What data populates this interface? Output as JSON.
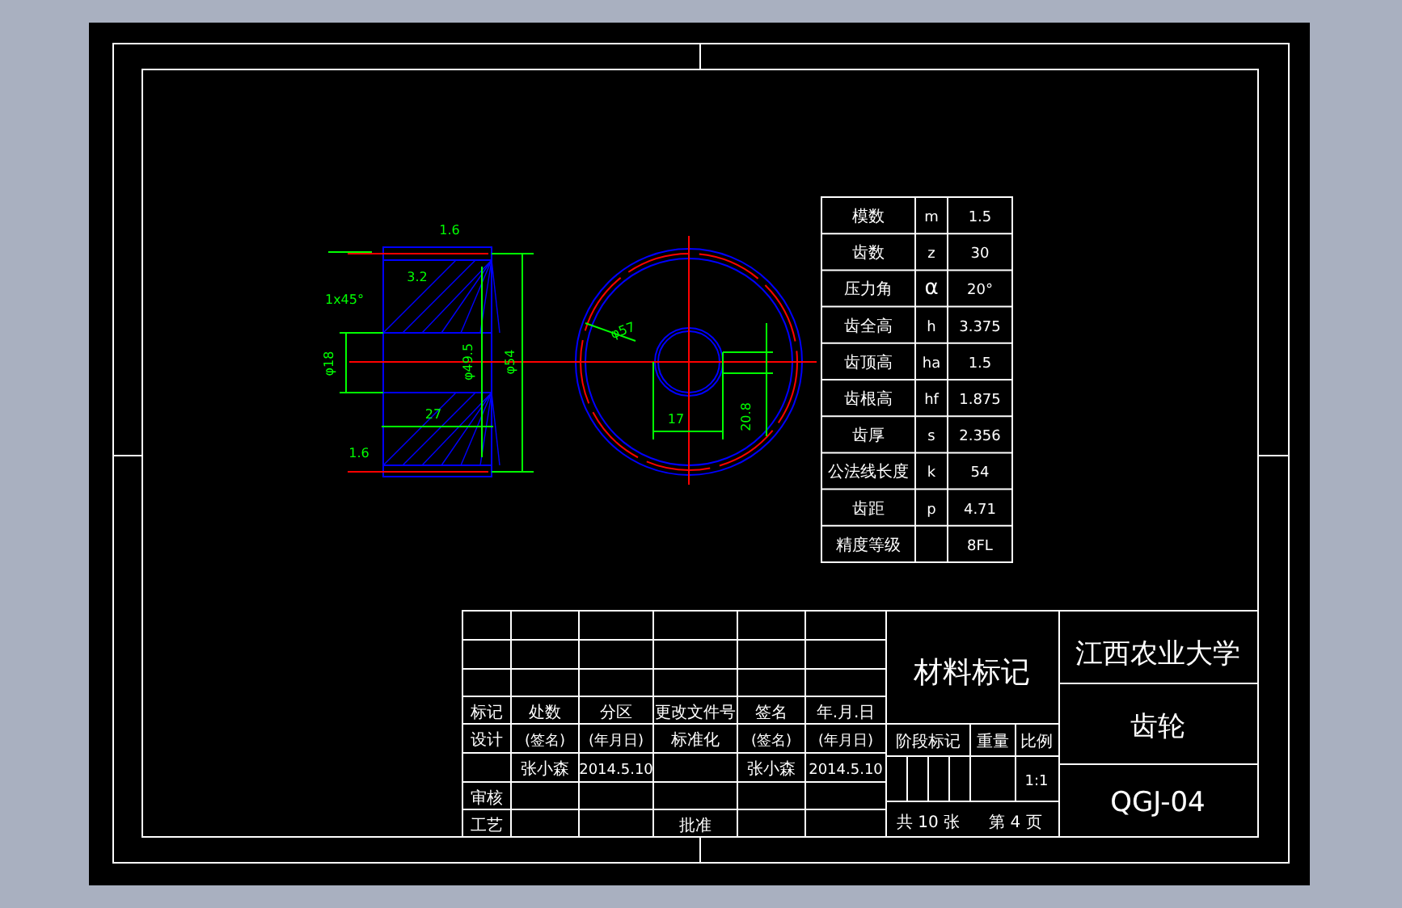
{
  "front_view": {
    "annotations": [
      "1.6",
      "1x45°",
      "3.2",
      "φ18",
      "φ49.5",
      "φ54",
      "27",
      "1.6"
    ]
  },
  "side_view": {
    "annotations": [
      "φ57",
      "17",
      "20.8"
    ]
  },
  "parameter_table": {
    "rows": [
      {
        "name": "模数",
        "symbol": "m",
        "value": "1.5"
      },
      {
        "name": "齿数",
        "symbol": "z",
        "value": "30"
      },
      {
        "name": "压力角",
        "symbol": "α",
        "value": "20°"
      },
      {
        "name": "齿全高",
        "symbol": "h",
        "value": "3.375"
      },
      {
        "name": "齿顶高",
        "symbol": "ha",
        "value": "1.5"
      },
      {
        "name": "齿根高",
        "symbol": "hf",
        "value": "1.875"
      },
      {
        "name": "齿厚",
        "symbol": "s",
        "value": "2.356"
      },
      {
        "name": "公法线长度",
        "symbol": "k",
        "value": "54"
      },
      {
        "name": "齿距",
        "symbol": "p",
        "value": "4.71"
      },
      {
        "name": "精度等级",
        "value": "8FL"
      }
    ]
  },
  "title_block": {
    "change_header": [
      "标记",
      "处数",
      "分区",
      "更改文件号",
      "签名",
      "年.月.日"
    ],
    "design": {
      "label": "设计",
      "signature": "(签名)",
      "date": "(年月日)",
      "name": "张小森",
      "filled_date": "2014.5.10"
    },
    "standardization": {
      "label": "标准化",
      "signature": "(签名)",
      "date": "(年月日)",
      "name": "张小森",
      "filled_date": "2014.5.10"
    },
    "review": "审核",
    "process": "工艺",
    "approval": "批准",
    "material": "材料标记",
    "organization": "江西农业大学",
    "part_name": "齿轮",
    "stage_header": [
      "阶段标记",
      "重量",
      "比例"
    ],
    "scale": "1:1",
    "sheets": "共 10 张",
    "sheet": "第 4 页",
    "drawing_number": "QGJ-04"
  }
}
